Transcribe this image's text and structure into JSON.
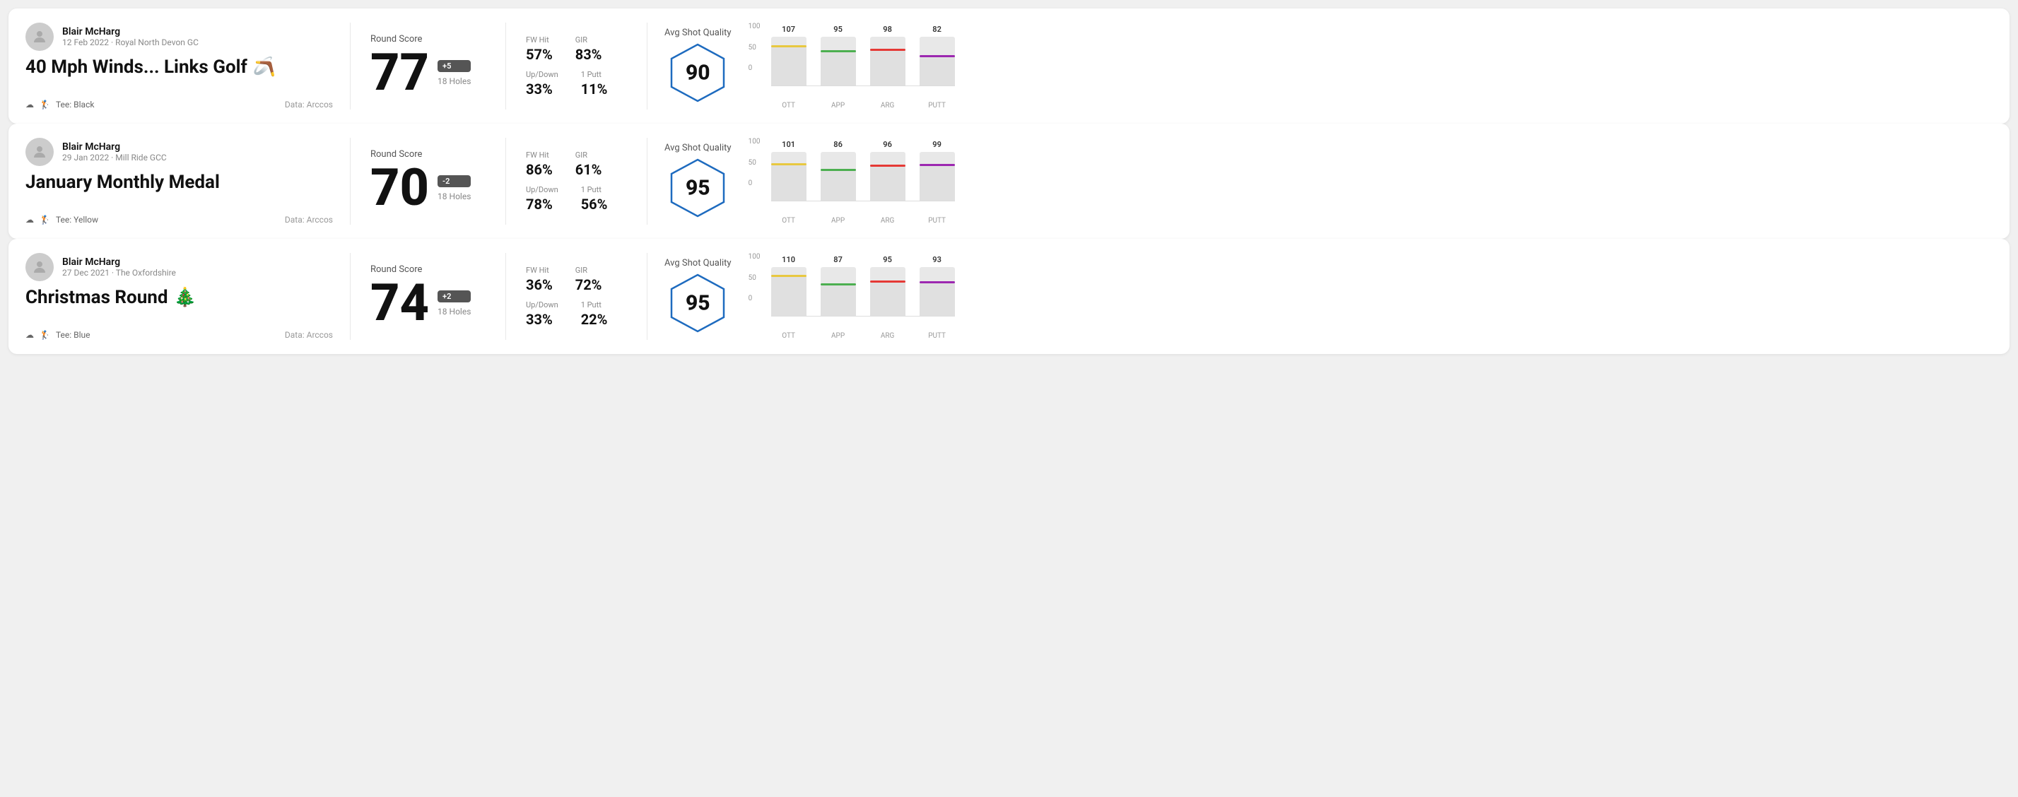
{
  "rounds": [
    {
      "user_name": "Blair McHarg",
      "date": "12 Feb 2022 · Royal North Devon GC",
      "title": "40 Mph Winds... Links Golf",
      "title_emoji": "🪃",
      "tee": "Tee: Black",
      "data_source": "Data: Arccos",
      "round_score_label": "Round Score",
      "score": "77",
      "badge": "+5",
      "holes": "18 Holes",
      "fw_hit_label": "FW Hit",
      "fw_hit": "57%",
      "gir_label": "GIR",
      "gir": "83%",
      "updown_label": "Up/Down",
      "updown": "33%",
      "oneputt_label": "1 Putt",
      "oneputt": "11%",
      "avg_label": "Avg Shot Quality",
      "quality_score": "90",
      "bars": [
        {
          "label": "OTT",
          "value": 107,
          "color": "#e8c840",
          "max": 130
        },
        {
          "label": "APP",
          "value": 95,
          "color": "#4caf50",
          "max": 130
        },
        {
          "label": "ARG",
          "value": 98,
          "color": "#e53935",
          "max": 130
        },
        {
          "label": "PUTT",
          "value": 82,
          "color": "#9c27b0",
          "max": 130
        }
      ]
    },
    {
      "user_name": "Blair McHarg",
      "date": "29 Jan 2022 · Mill Ride GCC",
      "title": "January Monthly Medal",
      "title_emoji": "",
      "tee": "Tee: Yellow",
      "data_source": "Data: Arccos",
      "round_score_label": "Round Score",
      "score": "70",
      "badge": "-2",
      "holes": "18 Holes",
      "fw_hit_label": "FW Hit",
      "fw_hit": "86%",
      "gir_label": "GIR",
      "gir": "61%",
      "updown_label": "Up/Down",
      "updown": "78%",
      "oneputt_label": "1 Putt",
      "oneputt": "56%",
      "avg_label": "Avg Shot Quality",
      "quality_score": "95",
      "bars": [
        {
          "label": "OTT",
          "value": 101,
          "color": "#e8c840",
          "max": 130
        },
        {
          "label": "APP",
          "value": 86,
          "color": "#4caf50",
          "max": 130
        },
        {
          "label": "ARG",
          "value": 96,
          "color": "#e53935",
          "max": 130
        },
        {
          "label": "PUTT",
          "value": 99,
          "color": "#9c27b0",
          "max": 130
        }
      ]
    },
    {
      "user_name": "Blair McHarg",
      "date": "27 Dec 2021 · The Oxfordshire",
      "title": "Christmas Round",
      "title_emoji": "🎄",
      "tee": "Tee: Blue",
      "data_source": "Data: Arccos",
      "round_score_label": "Round Score",
      "score": "74",
      "badge": "+2",
      "holes": "18 Holes",
      "fw_hit_label": "FW Hit",
      "fw_hit": "36%",
      "gir_label": "GIR",
      "gir": "72%",
      "updown_label": "Up/Down",
      "updown": "33%",
      "oneputt_label": "1 Putt",
      "oneputt": "22%",
      "avg_label": "Avg Shot Quality",
      "quality_score": "95",
      "bars": [
        {
          "label": "OTT",
          "value": 110,
          "color": "#e8c840",
          "max": 130
        },
        {
          "label": "APP",
          "value": 87,
          "color": "#4caf50",
          "max": 130
        },
        {
          "label": "ARG",
          "value": 95,
          "color": "#e53935",
          "max": 130
        },
        {
          "label": "PUTT",
          "value": 93,
          "color": "#9c27b0",
          "max": 130
        }
      ]
    }
  ],
  "y_axis": {
    "top": "100",
    "mid": "50",
    "bottom": "0"
  }
}
